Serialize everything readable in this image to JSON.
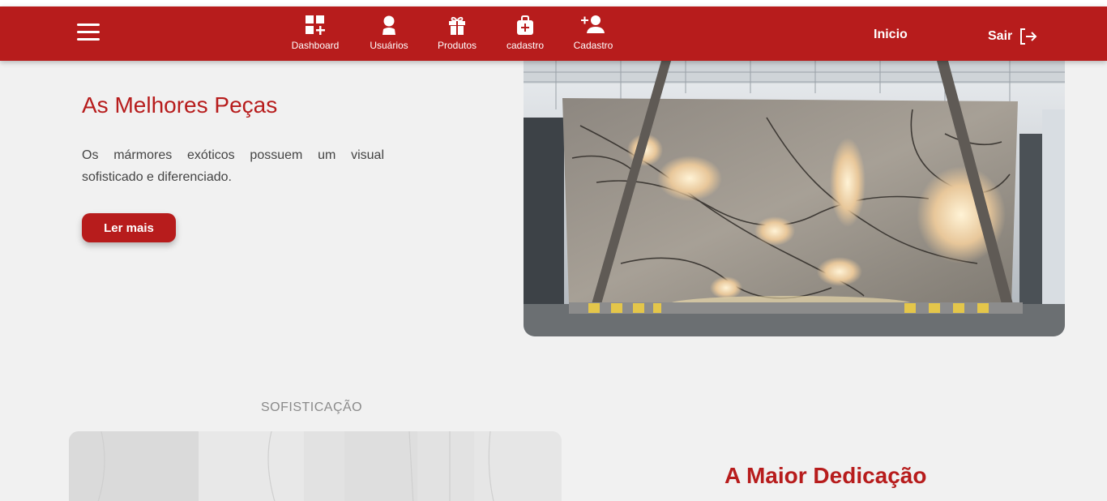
{
  "navbar": {
    "items": [
      {
        "label": "Dashboard",
        "icon": "dashboard-icon"
      },
      {
        "label": "Usuários",
        "icon": "user-icon"
      },
      {
        "label": "Produtos",
        "icon": "gift-icon"
      },
      {
        "label": "cadastro",
        "icon": "medical-bag-icon"
      },
      {
        "label": "Cadastro",
        "icon": "add-user-icon"
      }
    ],
    "inicio_label": "Inicio",
    "sair_label": "Sair"
  },
  "hero": {
    "title": "As Melhores Peças",
    "text": "Os mármores exóticos possuem um visual sofisticado e diferenciado.",
    "button_label": "Ler mais"
  },
  "section": {
    "label": "SOFISTICAÇÃO",
    "title": "A Maior Dedicação"
  },
  "colors": {
    "brand": "#b71c1c",
    "background": "#f1f1f1"
  }
}
